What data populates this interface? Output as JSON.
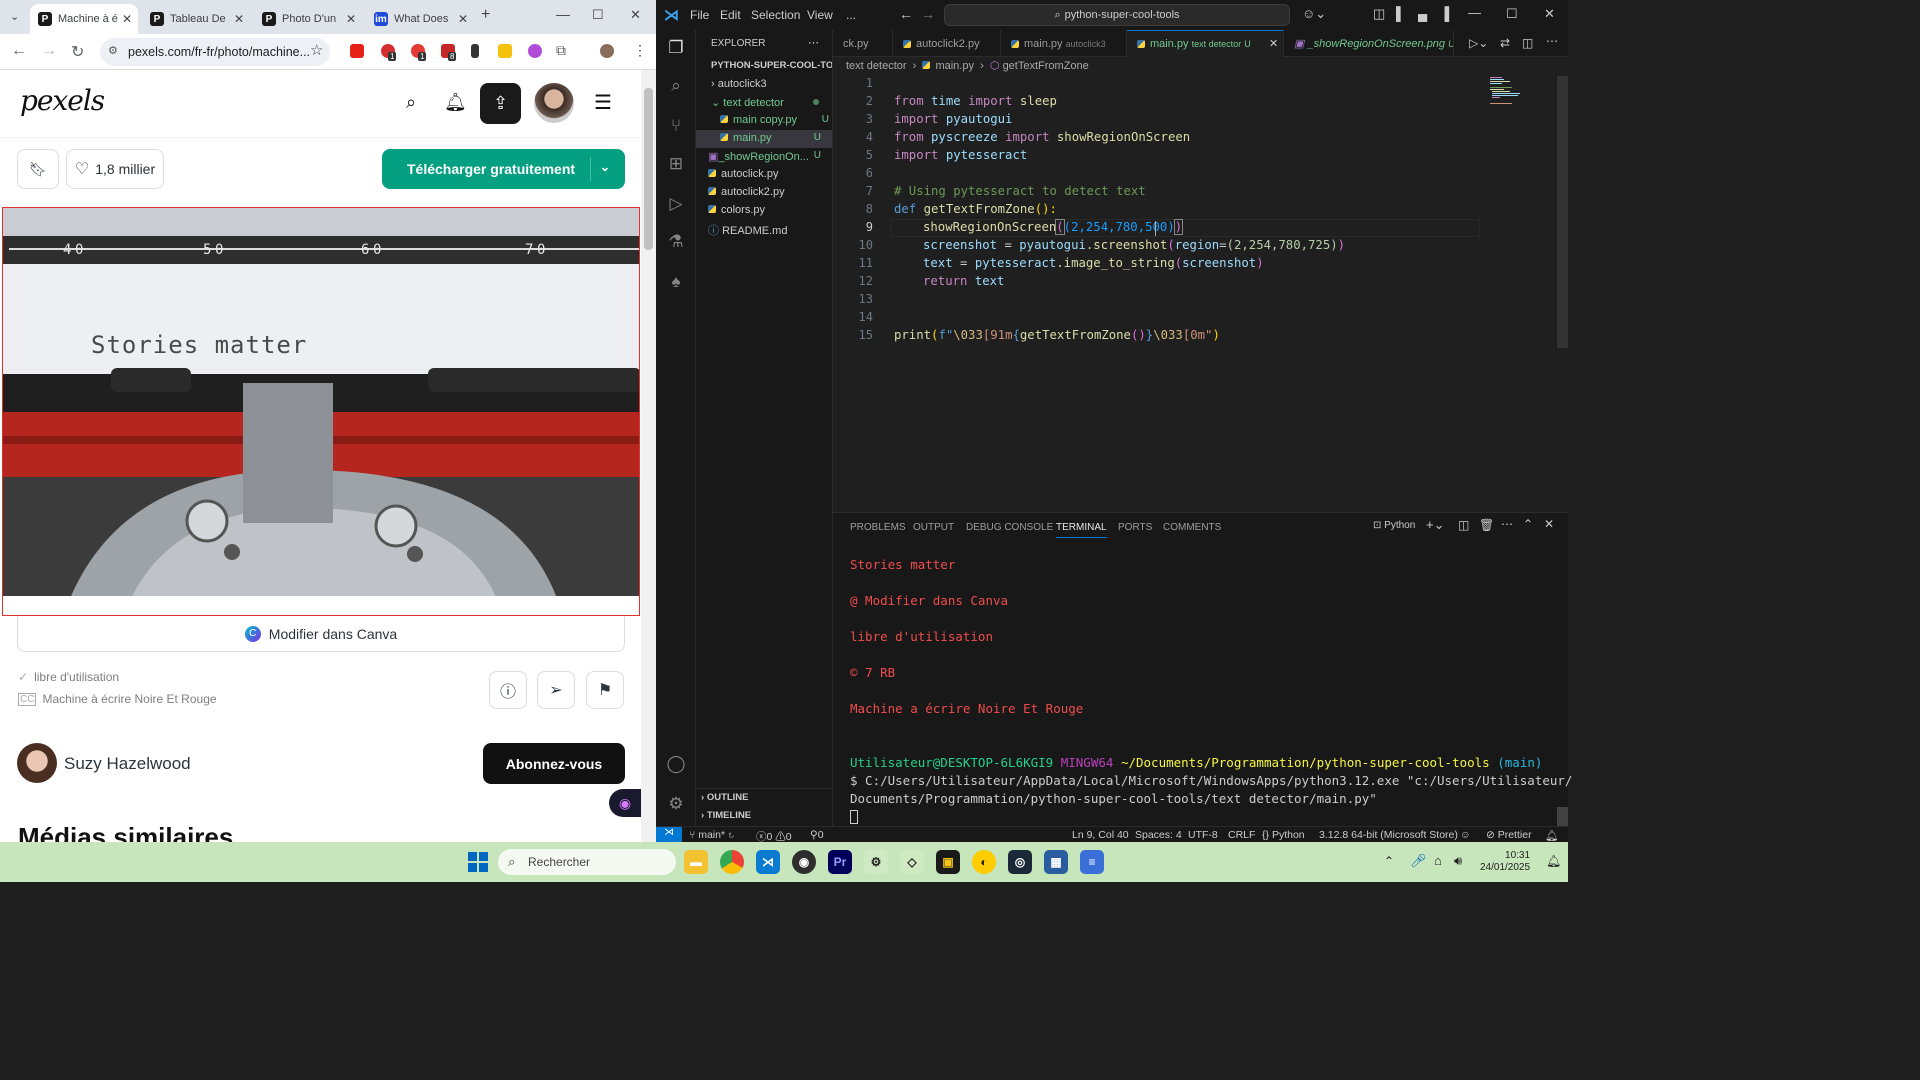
{
  "browser": {
    "tabs": [
      {
        "title": "Machine à é",
        "icon": "pexels-icon",
        "active": true
      },
      {
        "title": "Tableau De",
        "icon": "pexels-icon",
        "active": false
      },
      {
        "title": "Photo D'un",
        "icon": "pexels-icon",
        "active": false
      },
      {
        "title": "What Does",
        "icon": "im-icon",
        "active": false
      }
    ],
    "url": "pexels.com/fr-fr/photo/machine...",
    "ext_badges": [
      "1",
      "1",
      "8"
    ]
  },
  "pexels": {
    "logo": "pexels",
    "like_count": "1,8 millier",
    "download_label": "Télécharger gratuitement",
    "photo_text": "Stories matter",
    "ruler_numbers": [
      "4",
      "0",
      "5",
      "0",
      "6",
      "0",
      "7",
      "0"
    ],
    "canva_label": "Modifier dans Canva",
    "license": "libre d'utilisation",
    "caption": "Machine à écrire Noire Et Rouge",
    "author": "Suzy Hazelwood",
    "follow_label": "Abonnez-vous",
    "similar_heading": "Médias similaires"
  },
  "vscode": {
    "menu": [
      "File",
      "Edit",
      "Selection",
      "View",
      "..."
    ],
    "command_center": "python-super-cool-tools",
    "explorer_title": "EXPLORER",
    "project": "PYTHON-SUPER-COOL-TO...",
    "tree": [
      {
        "label": "autoclick3",
        "type": "folder",
        "indent": 0,
        "open": false
      },
      {
        "label": "text detector",
        "type": "folder",
        "indent": 0,
        "open": true,
        "dot": true
      },
      {
        "label": "main copy.py",
        "type": "py",
        "indent": 1,
        "badge": "U"
      },
      {
        "label": "main.py",
        "type": "py",
        "indent": 1,
        "badge": "U",
        "selected": true
      },
      {
        "label": "_showRegionOn...",
        "type": "png",
        "indent": 0,
        "badge": "U"
      },
      {
        "label": "autoclick.py",
        "type": "py",
        "indent": 0
      },
      {
        "label": "autoclick2.py",
        "type": "py",
        "indent": 0
      },
      {
        "label": "colors.py",
        "type": "py",
        "indent": 0
      },
      {
        "label": "README.md",
        "type": "md",
        "indent": 0
      }
    ],
    "outline": "OUTLINE",
    "timeline": "TIMELINE",
    "editor_tabs": [
      {
        "label": "ck.py",
        "desc": ""
      },
      {
        "label": "autoclick2.py",
        "desc": ""
      },
      {
        "label": "main.py",
        "desc": "autoclick3"
      },
      {
        "label": "main.py",
        "desc": "text detector",
        "badge": "U",
        "active": true
      },
      {
        "label": "_showRegionOnScreen.png",
        "desc": "",
        "badge": "U"
      }
    ],
    "breadcrumb": [
      "text detector",
      "main.py",
      "getTextFromZone"
    ],
    "line_numbers": [
      "1",
      "2",
      "3",
      "4",
      "5",
      "6",
      "7",
      "8",
      "9",
      "10",
      "11",
      "12",
      "13",
      "14",
      "15"
    ],
    "current_line": "9",
    "code": {
      "l2": [
        "from",
        "time",
        "import",
        "sleep"
      ],
      "l3": [
        "import",
        "pyautogui"
      ],
      "l4": [
        "from",
        "pyscreeze",
        "import",
        "showRegionOnScreen"
      ],
      "l5": [
        "import",
        "pytesseract"
      ],
      "l7": "# Using pytesseract to detect text",
      "l8": [
        "def",
        "getTextFromZone",
        "():"
      ],
      "l9": [
        "showRegionOnScreen",
        "(",
        "(2,254,780,500)",
        ")"
      ],
      "l10": [
        "screenshot",
        "=",
        "pyautogui",
        ".screenshot",
        "(",
        "region",
        "=",
        "(2,254,780,725)",
        ")"
      ],
      "l11": [
        "text",
        "=",
        "pytesseract",
        ".image_to_string",
        "(",
        "screenshot",
        ")"
      ],
      "l12": [
        "return",
        "text"
      ],
      "l15": [
        "print",
        "(",
        "f\"",
        "\\033",
        "[91m",
        "{",
        "getTextFromZone",
        "()",
        "}",
        "\\033",
        "[0m",
        "\"",
        ")"
      ]
    },
    "panel_tabs": [
      "PROBLEMS",
      "OUTPUT",
      "DEBUG CONSOLE",
      "TERMINAL",
      "PORTS",
      "COMMENTS"
    ],
    "terminal_profile": "Python",
    "terminal_output": [
      "Stories matter",
      "@ Modifier dans Canva",
      "libre d'utilisation",
      "© 7 RB",
      "Machine a écrire Noire Et Rouge"
    ],
    "prompt": {
      "user": "Utilisateur@DESKTOP-6L6KGI9",
      "shell": "MINGW64",
      "path": "~/Documents/Programmation/python-super-cool-tools",
      "branch": "(main)"
    },
    "command_line1": "$ C:/Users/Utilisateur/AppData/Local/Microsoft/WindowsApps/python3.12.exe \"c:/Users/Utilisateur/",
    "command_line2": "Documents/Programmation/python-super-cool-tools/text detector/main.py\"",
    "status": {
      "branch": "main*",
      "errors": "0",
      "warnings": "0",
      "ports": "0",
      "position": "Ln 9, Col 40",
      "spaces": "Spaces: 4",
      "encoding": "UTF-8",
      "eol": "CRLF",
      "language": "Python",
      "interpreter": "3.12.8 64-bit (Microsoft Store)",
      "formatter": "Prettier"
    }
  },
  "taskbar": {
    "search_placeholder": "Rechercher",
    "time": "10:31",
    "date": "24/01/2025"
  }
}
